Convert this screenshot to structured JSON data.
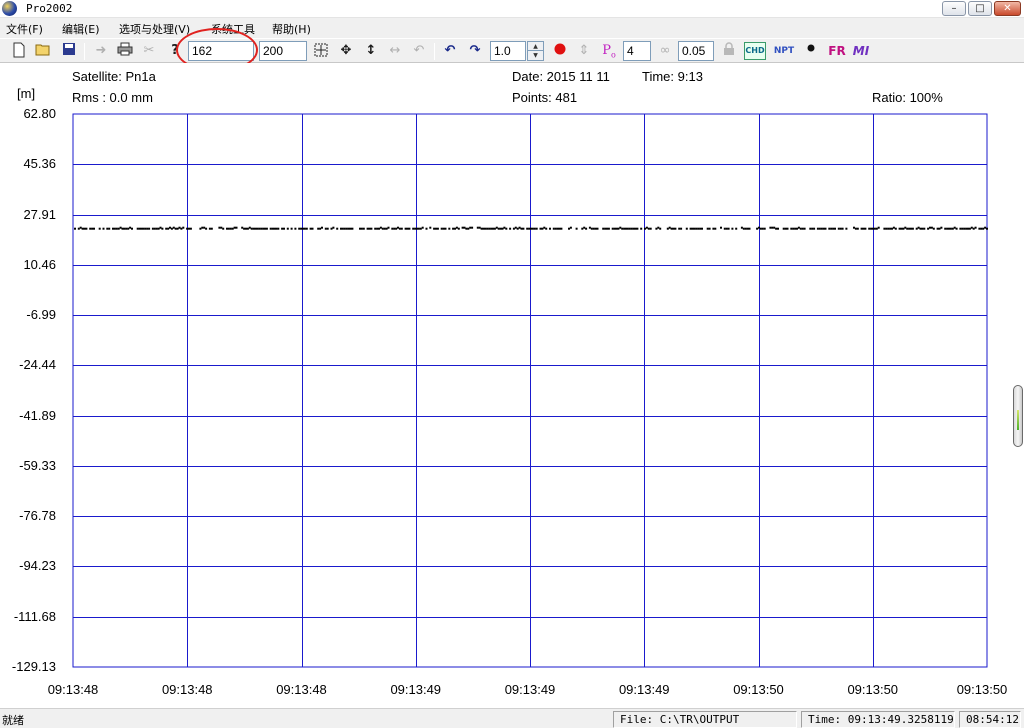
{
  "window": {
    "title": "Pro2002",
    "controls": {
      "minimize": "–",
      "maximize": "□",
      "close": "✕"
    }
  },
  "menu": [
    {
      "label": "文件(F)"
    },
    {
      "label": "编辑(E)"
    },
    {
      "label": "选项与处理(V)"
    },
    {
      "label": "系统工具"
    },
    {
      "label": "帮助(H)"
    }
  ],
  "toolbar": {
    "icons": {
      "new": "new-file-icon",
      "open": "open-folder-icon",
      "save": "save-icon",
      "forward": "arrow-right-icon",
      "print": "print-icon",
      "cut": "scissors-icon",
      "help": "help-icon",
      "zoom_fit": "zoom-fit-icon",
      "pan": "pan-icon",
      "vertical": "vertical-arrows-icon",
      "horizontal": "horizontal-arrows-icon",
      "undo": "undo-icon",
      "rotate_left": "rotate-left-icon",
      "rotate_right": "rotate-right-icon",
      "record": "record-dot-icon",
      "updown": "updown-icon",
      "poly": "polynomial-icon",
      "curve": "curve-icon",
      "lock": "lock-icon",
      "chd": "chd-icon",
      "npt": "npt-icon",
      "dot": "dot-icon",
      "fr": "fr-icon",
      "mi": "mi-icon"
    },
    "start_epoch": "162",
    "end_epoch": "200",
    "step": "1.0",
    "poly_label": "P",
    "poly_sub": "o",
    "order": "4",
    "threshold": "0.05",
    "chd_label": "CHD",
    "npt_label": "NPT",
    "fr_label": "FR",
    "mi_label": "MI"
  },
  "plot_info": {
    "satellite": "Satellite: Pn1a",
    "rms": "Rms :   0.0 mm",
    "date": "Date: 2015 11 11",
    "time": "Time:  9:13",
    "points": "Points:   481",
    "ratio": "Ratio: 100%",
    "unit": "[m]"
  },
  "chart_data": {
    "type": "scatter",
    "title": "",
    "xlabel": "",
    "ylabel": "[m]",
    "ylim": [
      -129.13,
      62.8
    ],
    "y_ticks": [
      "62.80",
      "45.36",
      "27.91",
      "10.46",
      "-6.99",
      "-24.44",
      "-41.89",
      "-59.33",
      "-76.78",
      "-94.23",
      "-111.68",
      "-129.13"
    ],
    "x_ticks": [
      "09:13:48",
      "09:13:48",
      "09:13:48",
      "09:13:49",
      "09:13:49",
      "09:13:49",
      "09:13:50",
      "09:13:50",
      "09:13:50"
    ],
    "grid": true,
    "series": [
      {
        "approx_value": 23.0,
        "point_count": 481
      }
    ],
    "colors": {
      "grid": "#1a1acd",
      "points": "#000000"
    }
  },
  "status": {
    "text": "就绪",
    "file": "File: C:\\TR\\OUTPUT",
    "time": "Time: 09:13:49.3258119",
    "clock": "08:54:12"
  }
}
